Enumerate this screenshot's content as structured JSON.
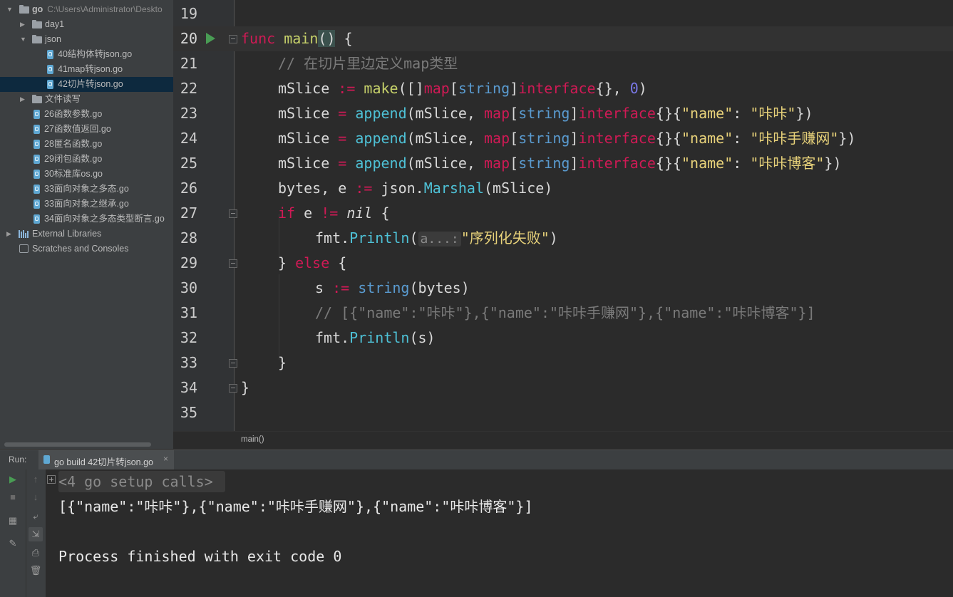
{
  "project": {
    "root_name": "go",
    "root_path": "C:\\Users\\Administrator\\Deskto",
    "items": [
      {
        "label": "day1",
        "kind": "folder",
        "level": 1,
        "expanded": false
      },
      {
        "label": "json",
        "kind": "folder",
        "level": 1,
        "expanded": true
      },
      {
        "label": "40结构体转json.go",
        "kind": "gofile",
        "level": 2
      },
      {
        "label": "41map转json.go",
        "kind": "gofile",
        "level": 2
      },
      {
        "label": "42切片转json.go",
        "kind": "gofile",
        "level": 2,
        "selected": true
      },
      {
        "label": "文件读写",
        "kind": "folder",
        "level": 1,
        "expanded": false
      },
      {
        "label": "26函数参数.go",
        "kind": "gofile",
        "level": 1
      },
      {
        "label": "27函数值返回.go",
        "kind": "gofile",
        "level": 1
      },
      {
        "label": "28匿名函数.go",
        "kind": "gofile",
        "level": 1
      },
      {
        "label": "29闭包函数.go",
        "kind": "gofile",
        "level": 1
      },
      {
        "label": "30标准库os.go",
        "kind": "gofile",
        "level": 1
      },
      {
        "label": "33面向对象之多态.go",
        "kind": "gofile",
        "level": 1
      },
      {
        "label": "33面向对象之继承.go",
        "kind": "gofile",
        "level": 1
      },
      {
        "label": "34面向对象之多态类型断言.go",
        "kind": "gofile",
        "level": 1
      }
    ],
    "external_libraries": "External Libraries",
    "scratches": "Scratches and Consoles"
  },
  "editor": {
    "line_numbers": [
      "19",
      "20",
      "21",
      "22",
      "23",
      "24",
      "25",
      "26",
      "27",
      "28",
      "29",
      "30",
      "31",
      "32",
      "33",
      "34",
      "35"
    ],
    "current_line": "20",
    "code": {
      "l20": {
        "kw": "func ",
        "name": "main",
        "rest": " {"
      },
      "l21": "// 在切片里边定义map类型",
      "l22": {
        "a": "mSlice ",
        "op": ":= ",
        "fn": "make",
        "b": "([]",
        "map": "map",
        "lb": "[",
        "ty": "string",
        "rb": "]",
        "iface": "interface",
        "c": "{}, ",
        "num": "0",
        "d": ")"
      },
      "l23": {
        "a": "mSlice ",
        "op": "= ",
        "fn": "append",
        "b": "(mSlice, ",
        "map": "map",
        "lb": "[",
        "ty": "string",
        "rb": "]",
        "iface": "interface",
        "c": "{}{",
        "key": "\"name\"",
        "colon": ": ",
        "val": "\"咔咔\"",
        "d": "})"
      },
      "l24": {
        "a": "mSlice ",
        "op": "= ",
        "fn": "append",
        "b": "(mSlice, ",
        "map": "map",
        "lb": "[",
        "ty": "string",
        "rb": "]",
        "iface": "interface",
        "c": "{}{",
        "key": "\"name\"",
        "colon": ": ",
        "val": "\"咔咔手赚网\"",
        "d": "})"
      },
      "l25": {
        "a": "mSlice ",
        "op": "= ",
        "fn": "append",
        "b": "(mSlice, ",
        "map": "map",
        "lb": "[",
        "ty": "string",
        "rb": "]",
        "iface": "interface",
        "c": "{}{",
        "key": "\"name\"",
        "colon": ": ",
        "val": "\"咔咔博客\"",
        "d": "})"
      },
      "l26": {
        "a": "bytes, e ",
        "op": ":= ",
        "b": "json.",
        "fn": "Marshal",
        "c": "(mSlice)"
      },
      "l27": {
        "kw": "if ",
        "a": "e ",
        "op": "!= ",
        "nil": "nil",
        "b": " {"
      },
      "l28": {
        "a": "fmt.",
        "fn": "Println",
        "b": "(",
        "hint": "a...:",
        "str": "\"序列化失败\"",
        "c": ")"
      },
      "l29": {
        "a": "} ",
        "kw": "else",
        "b": " {"
      },
      "l30": {
        "a": "s ",
        "op": ":= ",
        "ty": "string",
        "b": "(bytes)"
      },
      "l31": "// [{\"name\":\"咔咔\"},{\"name\":\"咔咔手赚网\"},{\"name\":\"咔咔博客\"}]",
      "l32": {
        "a": "fmt.",
        "fn": "Println",
        "b": "(s)"
      },
      "l33": "}",
      "l34": "}"
    },
    "breadcrumb": "main()"
  },
  "run": {
    "label": "Run:",
    "tab": "go build 42切片转json.go",
    "close": "×",
    "console": {
      "setup": "<4 go setup calls>",
      "output": "[{\"name\":\"咔咔\"},{\"name\":\"咔咔手赚网\"},{\"name\":\"咔咔博客\"}]",
      "exit": "Process finished with exit code 0"
    }
  },
  "colors": {
    "keyword": "#cf1a55",
    "string": "#e8d27a",
    "type": "#5a9bd0",
    "comment": "#7a7a7a",
    "run_green": "#499c54"
  }
}
